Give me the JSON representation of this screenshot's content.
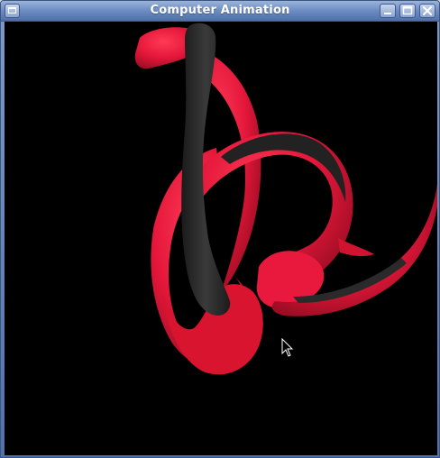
{
  "window": {
    "title": "Computer Animation"
  },
  "titlebar_icons": {
    "window_menu": "window-menu-icon",
    "minimize": "minimize-icon",
    "maximize": "maximize-icon",
    "close": "close-icon"
  },
  "colors": {
    "ribbon_red": "#e4173a",
    "ribbon_shadow": "#2a2a2a",
    "canvas_background": "#000000"
  }
}
